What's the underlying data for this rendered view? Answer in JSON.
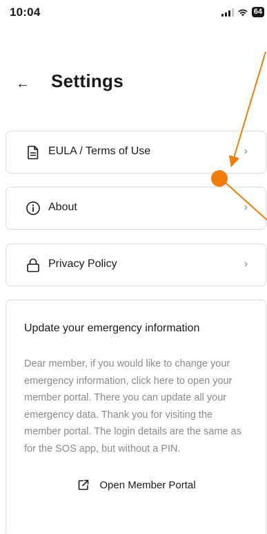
{
  "status_bar": {
    "time": "10:04",
    "battery": "64"
  },
  "header": {
    "back_icon": "arrow-left-icon",
    "title": "Settings"
  },
  "settings_items": [
    {
      "icon": "document-icon",
      "label": "EULA / Terms of Use",
      "chevron": "›"
    },
    {
      "icon": "info-icon",
      "label": "About",
      "chevron": "›"
    },
    {
      "icon": "lock-icon",
      "label": "Privacy Policy",
      "chevron": "›"
    }
  ],
  "emergency_card": {
    "title": "Update your emergency information",
    "body": "Dear member, if you would like to change your emergency information, click here to open your member portal. There you can update all your emergency data. Thank you for visiting the member portal. The login details are the same as for the SOS app, but without a PIN.",
    "link_icon": "external-link-icon",
    "link_label": "Open Member Portal"
  },
  "colors": {
    "annotation": "#f07d0a",
    "muted_text": "#8a8a8a",
    "border": "#dcdcdc"
  }
}
